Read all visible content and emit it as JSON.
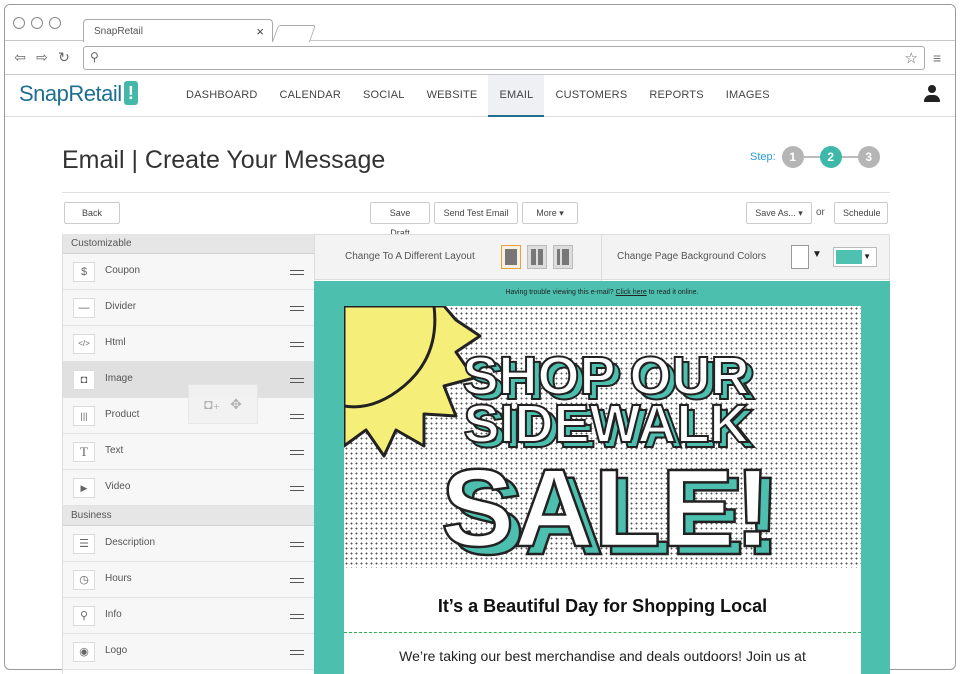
{
  "browser": {
    "tab_title": "SnapRetail",
    "tab_close": "×",
    "address_value": "",
    "nav_icons": [
      "back-arrow-icon",
      "forward-arrow-icon",
      "reload-icon"
    ]
  },
  "app": {
    "logo_text": "SnapRetail",
    "logo_mark": "!",
    "nav": [
      "DASHBOARD",
      "CALENDAR",
      "SOCIAL",
      "WEBSITE",
      "EMAIL",
      "CUSTOMERS",
      "REPORTS",
      "IMAGES"
    ],
    "active_nav": "EMAIL"
  },
  "page": {
    "title": "Email | Create Your Message",
    "steps_label": "Step:",
    "steps": [
      "1",
      "2",
      "3"
    ],
    "active_step": "2"
  },
  "actions": {
    "back": "Back",
    "save_draft": "Save Draft",
    "send_test": "Send Test Email",
    "more": "More ▾",
    "save_as": "Save As... ▾",
    "or": "or",
    "schedule": "Schedule"
  },
  "sidebar": {
    "customizable_header": "Customizable",
    "customizable_items": [
      {
        "label": "Coupon",
        "icon": "coupon-icon",
        "glyph": "$"
      },
      {
        "label": "Divider",
        "icon": "divider-icon",
        "glyph": "—"
      },
      {
        "label": "Html",
        "icon": "html-icon",
        "glyph": "</>"
      },
      {
        "label": "Image",
        "icon": "camera-icon",
        "glyph": "◘"
      },
      {
        "label": "Product",
        "icon": "barcode-icon",
        "glyph": "|||"
      },
      {
        "label": "Text",
        "icon": "text-icon",
        "glyph": "T"
      },
      {
        "label": "Video",
        "icon": "video-icon",
        "glyph": "▶"
      }
    ],
    "business_header": "Business",
    "business_items": [
      {
        "label": "Description",
        "icon": "list-icon",
        "glyph": "☰"
      },
      {
        "label": "Hours",
        "icon": "clock-icon",
        "glyph": "◷"
      },
      {
        "label": "Info",
        "icon": "location-pin-icon",
        "glyph": "⚲"
      },
      {
        "label": "Logo",
        "icon": "logo-icon",
        "glyph": "◉"
      }
    ]
  },
  "toolbar": {
    "layout_label": "Change To A Different Layout",
    "bg_label": "Change Page Background Colors",
    "bg_color": "#ffffff",
    "accent_color": "#4fc1b1"
  },
  "email": {
    "trouble_text": "Having trouble viewing this e-mail?",
    "trouble_link": "Click here",
    "trouble_tail": "to read it online.",
    "hero_line1": "SHOP OUR",
    "hero_line2": "SIDEWALK",
    "hero_line3": "SALE!",
    "headline": "It’s a Beautiful Day for Shopping Local",
    "body": "We’re taking our best merchandise and deals outdoors! Join us at"
  }
}
